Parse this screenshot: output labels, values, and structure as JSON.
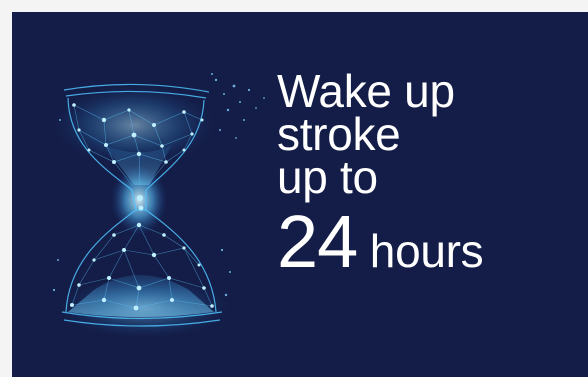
{
  "headline": {
    "line1": "Wake up",
    "line2": "stroke",
    "line3": "up to",
    "number": "24",
    "unit": " hours"
  },
  "illustration": {
    "icon": "hourglass-icon"
  },
  "colors": {
    "background": "#141d47",
    "text": "#ffffff",
    "glow": "#4fc3ff",
    "glow_core": "#b8ecff"
  }
}
